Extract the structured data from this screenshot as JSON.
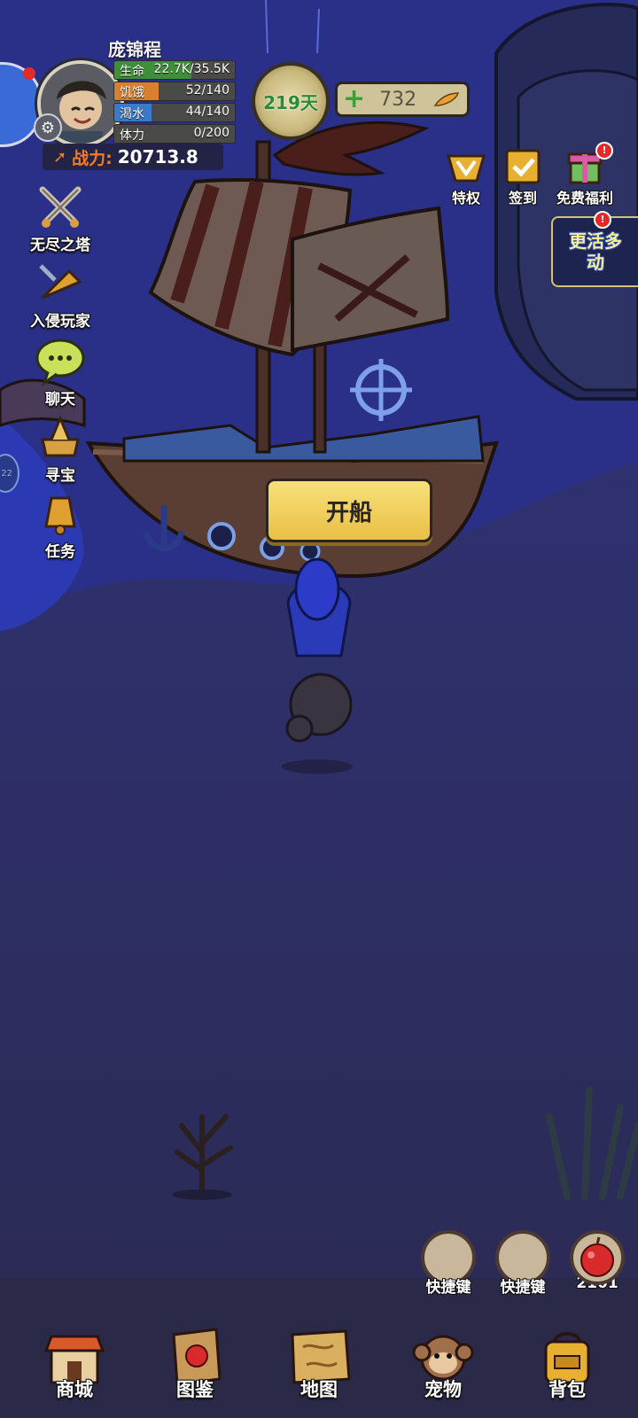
{
  "player": {
    "name": "庞锦程",
    "stats": [
      {
        "label": "生命",
        "value": "22.7K/35.5K",
        "fill": 0.64,
        "color": "#3f8f3a"
      },
      {
        "label": "饥饿",
        "value": "52/140",
        "fill": 0.37,
        "color": "#d9802e"
      },
      {
        "label": "渴水",
        "value": "44/140",
        "fill": 0.31,
        "color": "#3a7ac8"
      },
      {
        "label": "体力",
        "value": "0/200",
        "fill": 0.0,
        "color": "#c8b040"
      }
    ],
    "power_label": "战力:",
    "power_value": "20713.8"
  },
  "day": {
    "text": "219天"
  },
  "currency": {
    "value": "732",
    "plus_icon": "plus-icon",
    "currency_icon": "feather-icon"
  },
  "side_menu": [
    {
      "label": "无尽之塔",
      "icon": "crossed-swords-icon"
    },
    {
      "label": "入侵玩家",
      "icon": "horn-icon"
    },
    {
      "label": "聊天",
      "icon": "chat-bubble-icon"
    },
    {
      "label": "寻宝",
      "icon": "treasure-icon"
    },
    {
      "label": "任务",
      "icon": "bell-icon"
    }
  ],
  "top_right": [
    {
      "label": "特权",
      "icon": "vip-gem-icon"
    },
    {
      "label": "签到",
      "icon": "checkin-calendar-icon"
    },
    {
      "label": "免费福利",
      "icon": "gift-icon",
      "badge": "!"
    }
  ],
  "event": {
    "label": "更活多动",
    "badge": "!"
  },
  "action": {
    "sail_label": "开船"
  },
  "quick_slots": [
    {
      "label": "快捷键"
    },
    {
      "label": "快捷键"
    },
    {
      "label": "2101",
      "icon": "apple-icon"
    }
  ],
  "bottom_nav": [
    {
      "label": "商城",
      "icon": "shop-icon"
    },
    {
      "label": "图鉴",
      "icon": "book-icon"
    },
    {
      "label": "地图",
      "icon": "map-icon"
    },
    {
      "label": "宠物",
      "icon": "monkey-icon"
    },
    {
      "label": "背包",
      "icon": "backpack-icon"
    }
  ],
  "edge_badge": "22",
  "colors": {
    "accent_gold": "#e8c046",
    "night_bg": "#2a2e86",
    "power_orange": "#f27b2a"
  }
}
